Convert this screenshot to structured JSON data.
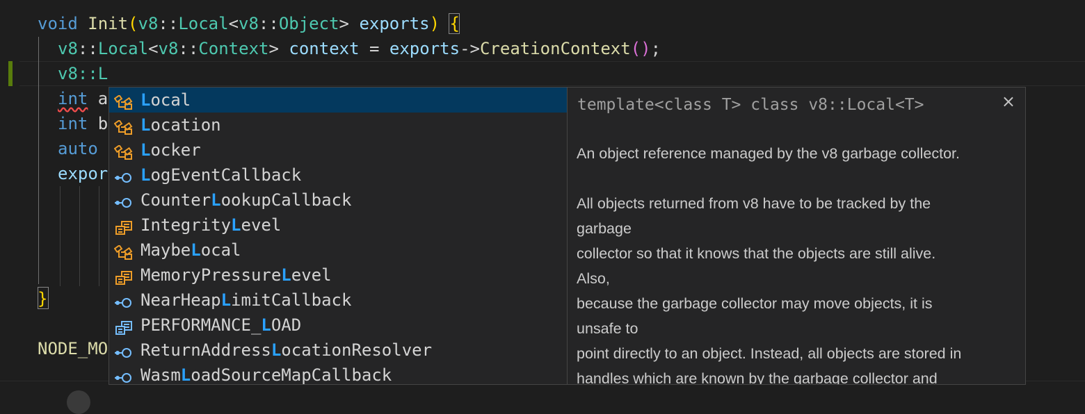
{
  "colors": {
    "keyword": "#569cd6",
    "type": "#4ec9b0",
    "function": "#dcdcaa",
    "variable": "#9cdcfe",
    "bracket": "#ffd700",
    "highlight": "#2aa1ff",
    "selection": "#04395e",
    "class_icon": "#ee9d28",
    "field_icon": "#75beff"
  },
  "code": {
    "l1": {
      "kw": "void",
      "fn": "Init",
      "ns1": "v8",
      "sep1": "::",
      "t1": "Local",
      "lt": "<",
      "ns2": "v8",
      "sep2": "::",
      "t2": "Object",
      "gt": ">",
      "var": "exports",
      "close": ")",
      "brace": "{"
    },
    "l2": {
      "ns": "v8",
      "sep": "::",
      "t": "Local",
      "lt": "<",
      "ns2": "v8",
      "sep2": "::",
      "t2": "Context",
      "gt": ">",
      "var": "context",
      "eq": " = ",
      "obj": "exports",
      "arrow": "->",
      "fn": "CreationContext",
      "paren": "()",
      "semi": ";"
    },
    "l3": {
      "text": "v8::L"
    },
    "l4": {
      "kw": "int",
      "rest": " a"
    },
    "l5": {
      "kw": "int",
      "rest": " b"
    },
    "l6": {
      "kw": "auto"
    },
    "l7": {
      "text": "expor"
    },
    "l12": {
      "brace": "}"
    },
    "l14": {
      "text": "NODE_MO"
    }
  },
  "suggestions": [
    {
      "icon": "class",
      "pre": "",
      "match": "L",
      "post": "ocal"
    },
    {
      "icon": "class",
      "pre": "",
      "match": "L",
      "post": "ocation"
    },
    {
      "icon": "class",
      "pre": "",
      "match": "L",
      "post": "ocker"
    },
    {
      "icon": "field",
      "pre": "",
      "match": "L",
      "post": "ogEventCallback"
    },
    {
      "icon": "field",
      "pre": "Counter",
      "match": "L",
      "post": "ookupCallback"
    },
    {
      "icon": "enum",
      "pre": "Integrity",
      "match": "L",
      "post": "evel"
    },
    {
      "icon": "class",
      "pre": "Maybe",
      "match": "L",
      "post": "ocal"
    },
    {
      "icon": "enum",
      "pre": "MemoryPressure",
      "match": "L",
      "post": "evel"
    },
    {
      "icon": "field",
      "pre": "NearHeap",
      "match": "L",
      "post": "imitCallback"
    },
    {
      "icon": "enum-member",
      "pre": "PERFORMANCE_",
      "match": "L",
      "post": "OAD"
    },
    {
      "icon": "field",
      "pre": "ReturnAddress",
      "match": "L",
      "post": "ocationResolver"
    },
    {
      "icon": "field",
      "pre": "Wasm",
      "match": "L",
      "post": "oadSourceMapCallback"
    }
  ],
  "details": {
    "signature": "template<class T> class v8::Local<T>",
    "close_icon": "close-icon",
    "close_glyph": "×",
    "lines": [
      "An object reference managed by the v8 garbage collector.",
      "",
      "All objects returned from v8 have to be tracked by the",
      "garbage",
      "collector so that it knows that the objects are still alive.",
      "Also,",
      "because the garbage collector may move objects, it is",
      "unsafe to",
      "point directly to an object. Instead, all objects are stored in",
      "handles which are known by the garbage collector and"
    ]
  }
}
